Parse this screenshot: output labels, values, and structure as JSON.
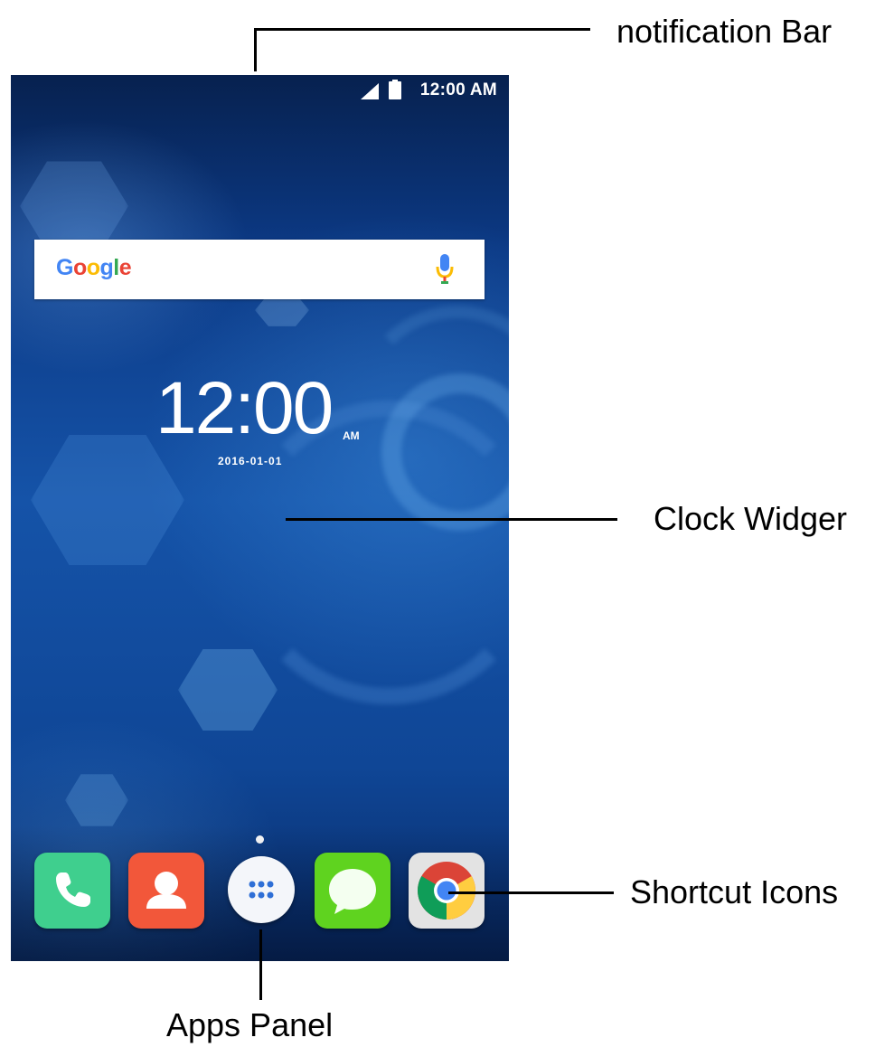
{
  "status_bar": {
    "time": "12:00 AM",
    "icons": [
      "signal-icon",
      "battery-icon"
    ]
  },
  "search_widget": {
    "logo_letters": [
      {
        "char": "G",
        "color": "#4285F4"
      },
      {
        "char": "o",
        "color": "#EA4335"
      },
      {
        "char": "o",
        "color": "#FBBC05"
      },
      {
        "char": "g",
        "color": "#4285F4"
      },
      {
        "char": "l",
        "color": "#34A853"
      },
      {
        "char": "e",
        "color": "#EA4335"
      }
    ],
    "mic_icon": "microphone-icon"
  },
  "clock_widget": {
    "time": "12:00",
    "ampm": "AM",
    "date": "2016-01-01"
  },
  "dock": {
    "apps": [
      {
        "name": "phone-icon",
        "color": "#3fcf8e"
      },
      {
        "name": "contacts-icon",
        "color": "#f2573a"
      },
      {
        "name": "apps-panel-icon",
        "color": "#f4f6fa"
      },
      {
        "name": "messages-icon",
        "color": "#5fd31f"
      },
      {
        "name": "chrome-icon",
        "color": "#e3e3e3"
      }
    ]
  },
  "annotations": {
    "notification_bar": "notification Bar",
    "clock_widget": "Clock Widger",
    "shortcut_icons": "Shortcut Icons",
    "apps_panel": "Apps Panel"
  }
}
